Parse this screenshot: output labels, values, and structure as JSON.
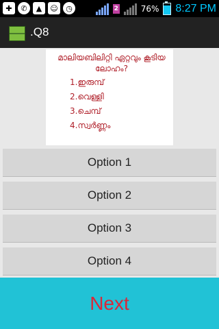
{
  "status_bar": {
    "battery_percent": "76%",
    "battery_level": 0.76,
    "time": "8:27 PM",
    "sim2_label": "2",
    "icons": [
      "plus-icon",
      "whatsapp-icon",
      "image-icon",
      "chat-icon",
      "alarm-icon",
      "signal-icon",
      "battery-icon"
    ]
  },
  "action_bar": {
    "title": ".Q8"
  },
  "question": {
    "text": "മാലിയബിലിറ്റി ഏറ്റവും കൂടിയ ലോഹം?",
    "choices": [
      "1.ഇരുമ്പ്",
      "2.വെള്ളി",
      "3.ചെമ്പ്",
      "4.സ്വർണ്ണം"
    ]
  },
  "options": [
    "Option 1",
    "Option 2",
    "Option 3",
    "Option 4"
  ],
  "next_label": "Next",
  "colors": {
    "next_bg": "#21c2d6",
    "next_text": "#d9283a",
    "question_text": "#b0202a",
    "clock": "#00c8ff"
  }
}
